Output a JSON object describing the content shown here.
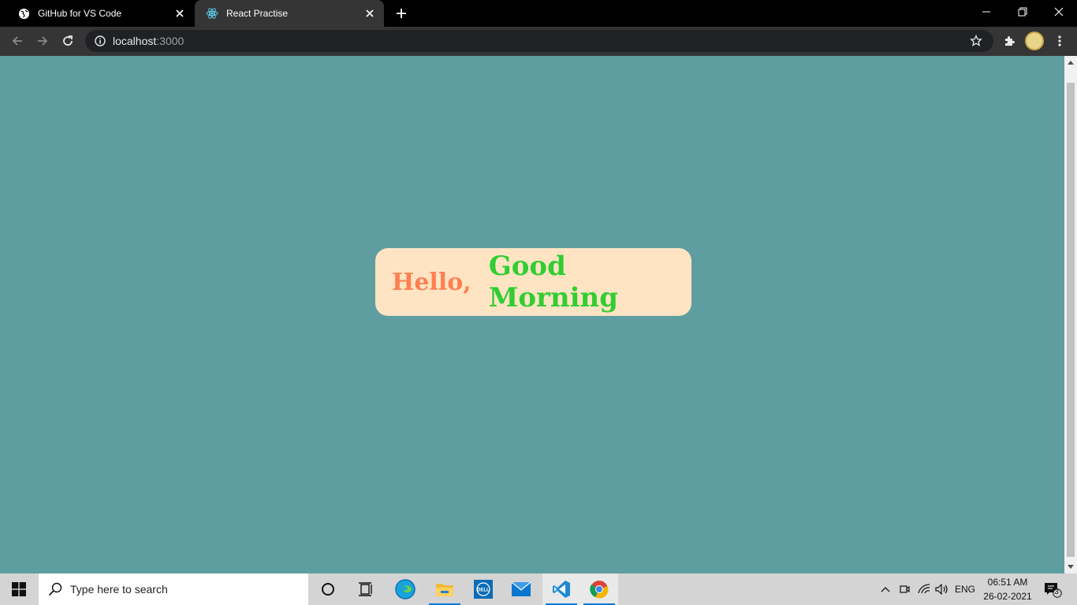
{
  "browser": {
    "tabs": [
      {
        "title": "GitHub for VS Code",
        "favicon": "globe-icon",
        "active": false
      },
      {
        "title": "React Practise",
        "favicon": "react-icon",
        "active": true
      }
    ],
    "url": {
      "host": "localhost",
      "port": ":3000"
    }
  },
  "page": {
    "background": "#5f9ea0",
    "card": {
      "background": "#ffe4c4",
      "hello": "Hello,",
      "hello_color": "#ff7f50",
      "greeting": "Good Morning",
      "greeting_color": "#32cd32"
    }
  },
  "taskbar": {
    "search_placeholder": "Type here to search",
    "apps": [
      "cortana-icon",
      "task-view-icon",
      "edge-icon",
      "file-explorer-icon",
      "dell-icon",
      "mail-icon",
      "vscode-icon",
      "chrome-icon"
    ],
    "language": "ENG",
    "time": "06:51 AM",
    "date": "26-02-2021",
    "notification_count": "3"
  }
}
